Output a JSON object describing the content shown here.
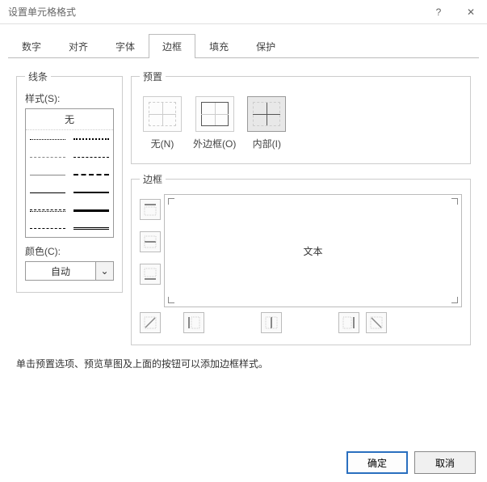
{
  "window": {
    "title": "设置单元格格式"
  },
  "tabs": [
    "数字",
    "对齐",
    "字体",
    "边框",
    "填充",
    "保护"
  ],
  "active_tab": 3,
  "line": {
    "group": "线条",
    "style_label": "样式(S):",
    "none": "无",
    "color_label": "颜色(C):",
    "color_value": "自动"
  },
  "preset": {
    "group": "预置",
    "items": [
      {
        "key": "none",
        "label": "无(N)"
      },
      {
        "key": "outline",
        "label": "外边框(O)"
      },
      {
        "key": "inside",
        "label": "内部(I)"
      }
    ]
  },
  "border": {
    "group": "边框",
    "preview_text": "文本"
  },
  "hint": "单击预置选项、预览草图及上面的按钮可以添加边框样式。",
  "footer": {
    "ok": "确定",
    "cancel": "取消"
  }
}
